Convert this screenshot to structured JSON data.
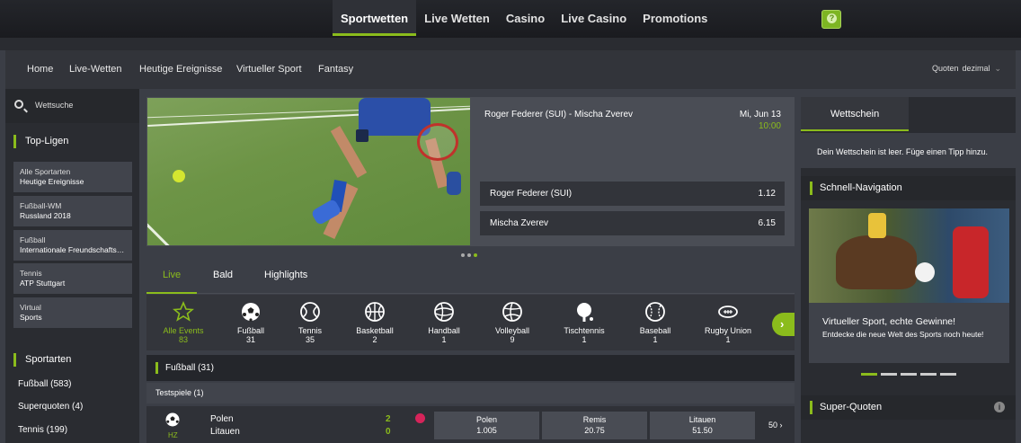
{
  "top_nav": [
    "Sportwetten",
    "Live Wetten",
    "Casino",
    "Live Casino",
    "Promotions"
  ],
  "help": "?",
  "main_nav": [
    "Home",
    "Live-Wetten",
    "Heutige Ereignisse",
    "Virtueller Sport",
    "Fantasy"
  ],
  "quoten": {
    "label": "Quoten",
    "value": "dezimal"
  },
  "search": {
    "placeholder": "Wettsuche"
  },
  "top_ligen": {
    "title": "Top-Ligen",
    "items": [
      {
        "l1": "Alle Sportarten",
        "l2": "Heutige Ereignisse"
      },
      {
        "l1": "Fußball-WM",
        "l2": "Russland 2018"
      },
      {
        "l1": "Fußball",
        "l2": "Internationale Freundschaftsspiele"
      },
      {
        "l1": "Tennis",
        "l2": "ATP Stuttgart"
      },
      {
        "l1": "Virtual",
        "l2": "Sports"
      }
    ]
  },
  "sportarten": {
    "title": "Sportarten",
    "items": [
      "Fußball (583)",
      "Superquoten (4)",
      "Tennis (199)"
    ]
  },
  "hero": {
    "title": "Roger Federer (SUI)  -  Mischa Zverev",
    "date": "Mi, Jun 13",
    "time": "10:00",
    "odds": [
      {
        "name": "Roger Federer (SUI)",
        "value": "1.12"
      },
      {
        "name": "Mischa Zverev",
        "value": "6.15"
      }
    ]
  },
  "tabs": [
    "Live",
    "Bald",
    "Highlights"
  ],
  "sports": [
    {
      "name": "Alle Events",
      "count": "83"
    },
    {
      "name": "Fußball",
      "count": "31"
    },
    {
      "name": "Tennis",
      "count": "35"
    },
    {
      "name": "Basketball",
      "count": "2"
    },
    {
      "name": "Handball",
      "count": "1"
    },
    {
      "name": "Volleyball",
      "count": "9"
    },
    {
      "name": "Tischtennis",
      "count": "1"
    },
    {
      "name": "Baseball",
      "count": "1"
    },
    {
      "name": "Rugby Union",
      "count": "1"
    }
  ],
  "group": {
    "title": "Fußball (31)",
    "sub": "Testspiele (1)"
  },
  "event": {
    "status": "HZ",
    "team1": "Polen",
    "team2": "Litauen",
    "score1": "2",
    "score2": "0",
    "odds": [
      {
        "h": "Polen",
        "v": "1.005"
      },
      {
        "h": "Remis",
        "v": "20.75"
      },
      {
        "h": "Litauen",
        "v": "51.50"
      }
    ],
    "more": "50 ›"
  },
  "wettschein": {
    "tab": "Wettschein",
    "empty": "Dein Wettschein ist leer. Füge einen Tipp hinzu."
  },
  "schnell": {
    "title": "Schnell-Navigation"
  },
  "promo": {
    "title": "Virtueller Sport, echte Gewinne!",
    "desc": "Entdecke die neue Welt des Sports noch heute!"
  },
  "super": {
    "title": "Super-Quoten"
  },
  "colors": {
    "accent": "#8bbc1c",
    "live": "#d6245a"
  }
}
